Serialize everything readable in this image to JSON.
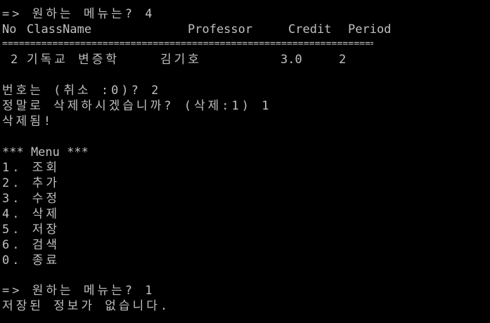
{
  "prompt_1": "=> 원하는 메뉴는? 4",
  "table": {
    "headers": {
      "no": "No",
      "class_name": "ClassName",
      "professor": "Professor",
      "credit": "Credit",
      "period": "Period"
    },
    "separator": "==========================================================================",
    "rows": [
      {
        "no": "2",
        "class_name": "기독교 변증학",
        "professor": "김기호",
        "credit": "3.0",
        "period": "2"
      }
    ]
  },
  "number_prompt": "번호는 (취소 :0)? 2",
  "confirm_prompt": "정말로 삭제하시겠습니까? (삭제:1) 1",
  "deleted_message": "삭제됨!",
  "menu": {
    "title": "*** Menu ***",
    "items": [
      "1. 조회",
      "2. 추가",
      "3. 수정",
      "4. 삭제",
      "5. 저장",
      "6. 검색",
      "0. 종료"
    ]
  },
  "prompt_2": "=> 원하는 메뉴는? 1",
  "no_data_message": "저장된 정보가 없습니다."
}
